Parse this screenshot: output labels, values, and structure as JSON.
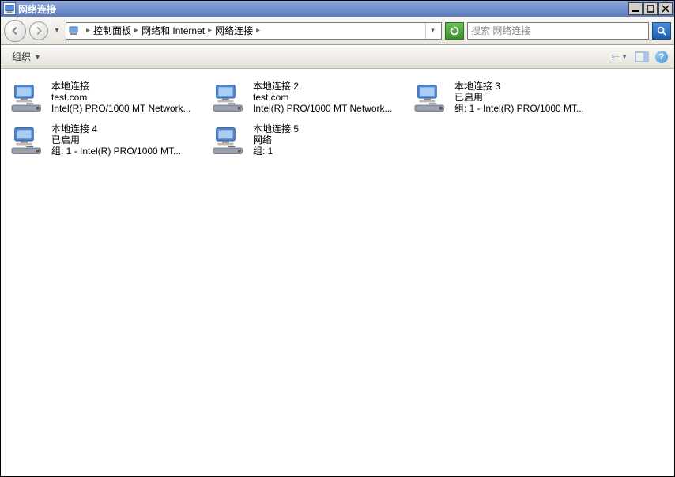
{
  "window": {
    "title": "网络连接"
  },
  "breadcrumb": {
    "item1": "控制面板",
    "item2": "网络和 Internet",
    "item3": "网络连接"
  },
  "search": {
    "placeholder": "搜索 网络连接"
  },
  "toolbar": {
    "organize": "组织"
  },
  "connections": [
    {
      "name": "本地连接",
      "line2": "test.com",
      "line3": "Intel(R) PRO/1000 MT Network..."
    },
    {
      "name": "本地连接 2",
      "line2": "test.com",
      "line3": "Intel(R) PRO/1000 MT Network..."
    },
    {
      "name": "本地连接 3",
      "line2": "已启用",
      "line3": "组: 1 - Intel(R) PRO/1000 MT..."
    },
    {
      "name": "本地连接 4",
      "line2": "已启用",
      "line3": "组: 1 - Intel(R) PRO/1000 MT..."
    },
    {
      "name": "本地连接 5",
      "line2": "网络",
      "line3": "组: 1"
    }
  ]
}
